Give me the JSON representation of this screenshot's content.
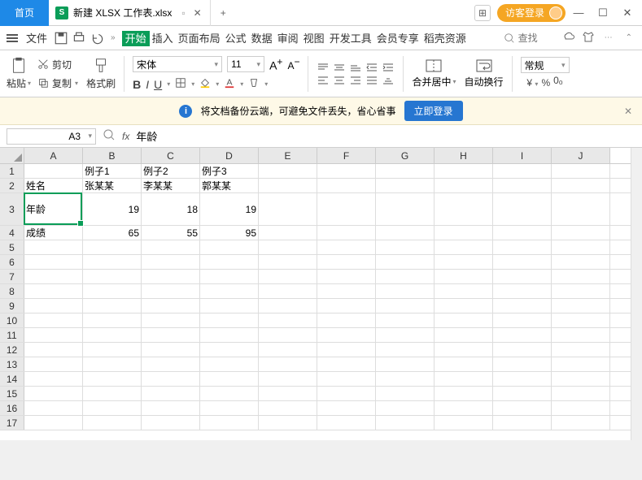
{
  "titlebar": {
    "home_tab": "首页",
    "file_tab": "新建 XLSX 工作表.xlsx",
    "plus": "+",
    "login": "访客登录"
  },
  "menu": {
    "file": "文件",
    "tabs": [
      "开始",
      "插入",
      "页面布局",
      "公式",
      "数据",
      "审阅",
      "视图",
      "开发工具",
      "会员专享",
      "稻壳资源"
    ],
    "search_ph": "查找"
  },
  "ribbon": {
    "paste": "粘贴",
    "cut": "剪切",
    "copy": "复制",
    "fmtpaint": "格式刷",
    "font_name": "宋体",
    "font_size": "11",
    "merge": "合并居中",
    "wrap": "自动换行",
    "numfmt": "常规"
  },
  "banner": {
    "text": "将文档备份云端，可避免文件丢失，省心省事",
    "button": "立即登录"
  },
  "fbar": {
    "name": "A3",
    "fx": "fx",
    "value": "年龄"
  },
  "sheet": {
    "cols": [
      "A",
      "B",
      "C",
      "D",
      "E",
      "F",
      "G",
      "H",
      "I",
      "J"
    ],
    "rows": 17,
    "active": {
      "row": 3,
      "col": 0
    },
    "data": {
      "1": {
        "B": "例子1",
        "C": "例子2",
        "D": "例子3"
      },
      "2": {
        "A": "姓名",
        "B": "张某某",
        "C": "李某某",
        "D": "郭某某"
      },
      "3": {
        "A": "年龄",
        "B": "19",
        "C": "18",
        "D": "19"
      },
      "4": {
        "A": "成绩",
        "B": "65",
        "C": "55",
        "D": "95"
      }
    }
  }
}
